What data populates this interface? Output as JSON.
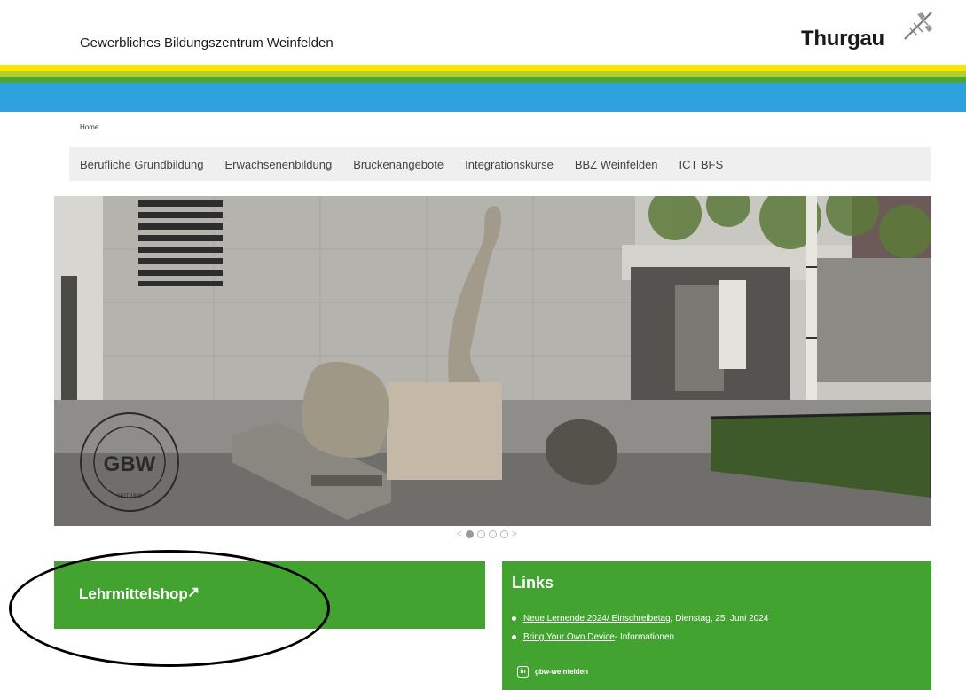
{
  "header": {
    "site_title": "Gewerbliches Bildungszentrum Weinfelden",
    "brand": "Thurgau"
  },
  "colors": {
    "stripe_yellow": "#ffe600",
    "stripe_lime": "#b3cf2a",
    "stripe_green": "#4aa83a",
    "stripe_blue": "#2da2dc",
    "accent_green": "#43a330",
    "nav_bg": "#efefef"
  },
  "breadcrumb": "Home",
  "nav": [
    "Berufliche Grundbildung",
    "Erwachsenenbildung",
    "Brückenangebote",
    "Integrationskurse",
    "BBZ Weinfelden",
    "ICT BFS"
  ],
  "hero": {
    "logo_text": "GBW",
    "logo_ring_text": "BILDUNG UND HANDWERK IM ZENTRUM",
    "logo_since": "SEIT 1893",
    "slide_index": 2,
    "slide_count": 4
  },
  "shop": {
    "label": "Lehrmittelshop",
    "arrow": "↗"
  },
  "links": {
    "title": "Links",
    "items": [
      {
        "link": "Neue Lernende 2024/ Einschreibetag",
        "text": ", Dienstag, 25. Juni 2024"
      },
      {
        "link": "Bring Your Own Device",
        "text": " - Informationen"
      }
    ],
    "social_icon": "linkedin-icon",
    "social_label": "gbw-weinfelden"
  }
}
